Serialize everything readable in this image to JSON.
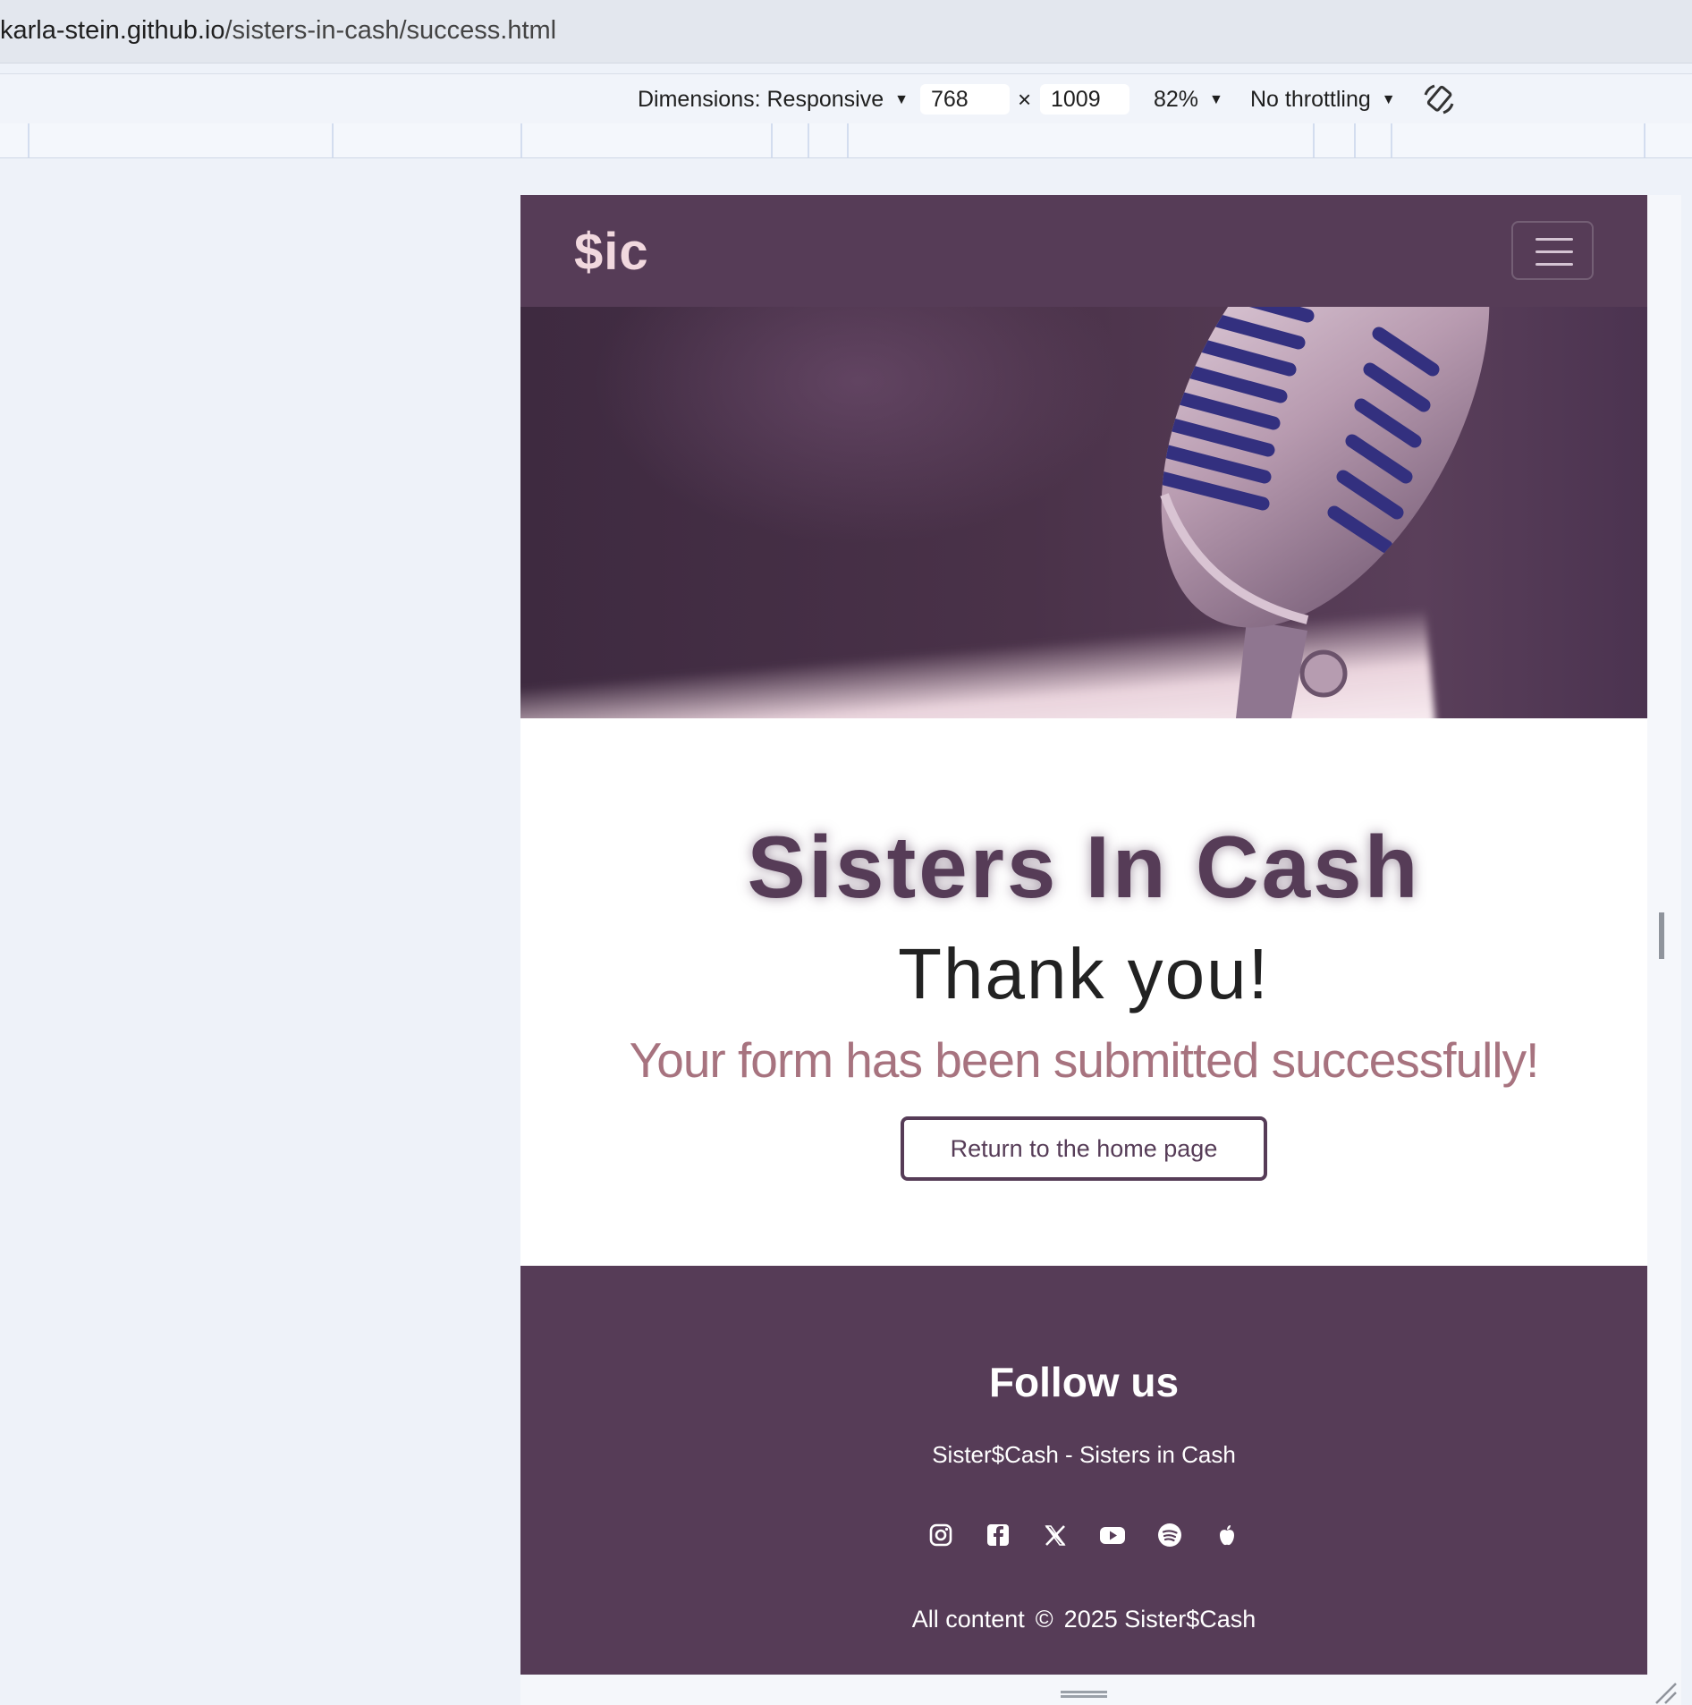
{
  "browser": {
    "url_host": "karla-stein.github.io",
    "url_path": "/sisters-in-cash/success.html"
  },
  "devtools": {
    "dimensions_label": "Dimensions: Responsive",
    "width_value": "768",
    "times_sign": "×",
    "height_value": "1009",
    "zoom": "82%",
    "throttling": "No throttling",
    "rotate_icon": "rotate-icon"
  },
  "navbar": {
    "brand": "$ic",
    "toggler_icon": "hamburger-icon"
  },
  "hero": {
    "image": "microphone-photo"
  },
  "content": {
    "site_title": "Sisters In Cash",
    "heading": "Thank you!",
    "message": "Your form has been submitted successfully!",
    "button_label": "Return to the home page"
  },
  "footer": {
    "heading": "Follow us",
    "tagline": "Sister$Cash - Sisters in Cash",
    "social_icons": [
      "instagram-icon",
      "facebook-icon",
      "x-icon",
      "youtube-icon",
      "spotify-icon",
      "apple-icon"
    ],
    "copyright_prefix": "All content",
    "copyright_symbol": "©",
    "copyright_suffix": "2025 Sister$Cash"
  },
  "colors": {
    "primary": "#563c57",
    "brand_text": "#f1d8de",
    "accent_text": "#a7737f"
  }
}
